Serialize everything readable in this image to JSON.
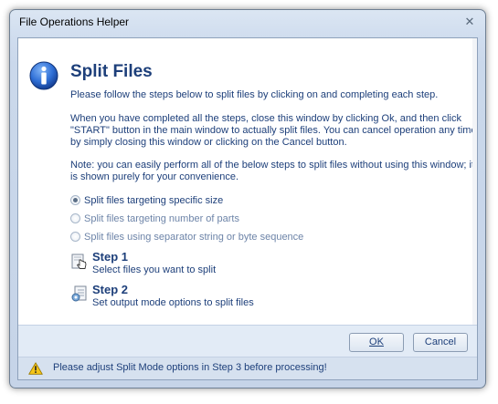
{
  "window": {
    "title": "File Operations Helper",
    "close_glyph": "✕"
  },
  "header": {
    "icon": "info-icon",
    "title": "Split Files"
  },
  "instructions": {
    "intro": "Please follow the steps below to split files by clicking on and completing each step.",
    "detail": "When you have completed all the steps, close this window by clicking Ok, and then click \"START\" button in the main window to actually split files. You can cancel operation any time by simply closing this window or clicking on the Cancel button.",
    "note": "Note: you can easily perform all of the below steps to split files without using this window; it is shown purely for your convenience."
  },
  "split_modes": [
    {
      "label": "Split files targeting specific size",
      "selected": true
    },
    {
      "label": "Split files targeting number of parts",
      "selected": false
    },
    {
      "label": "Split files using separator string or byte sequence",
      "selected": false
    }
  ],
  "steps": [
    {
      "title": "Step 1",
      "description": "Select files you want to split",
      "icon": "hand-pointer-icon"
    },
    {
      "title": "Step 2",
      "description": "Set output mode options to split files",
      "icon": "settings-document-icon"
    }
  ],
  "buttons": {
    "ok": "OK",
    "cancel": "Cancel"
  },
  "status": {
    "icon": "warning-icon",
    "message": "Please adjust Split Mode options in Step 3 before processing!"
  },
  "colors": {
    "text_primary": "#1d3f7a",
    "window_frame": "#cfdcee",
    "status_bar": "#d6e1ef"
  }
}
